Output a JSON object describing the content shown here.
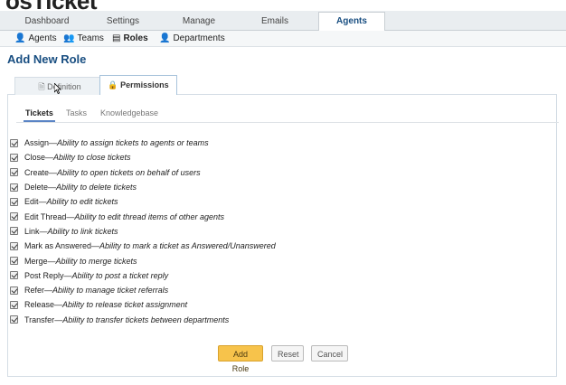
{
  "brand": {
    "logo_text": "osTicket",
    "logo_prefix": "o"
  },
  "main_nav": {
    "tabs": [
      {
        "label": "Dashboard"
      },
      {
        "label": "Settings"
      },
      {
        "label": "Manage"
      },
      {
        "label": "Emails"
      },
      {
        "label": "Agents",
        "active": true
      }
    ]
  },
  "sub_nav": {
    "items": [
      {
        "label": "Agents",
        "icon": "agent-icon"
      },
      {
        "label": "Teams",
        "icon": "teams-icon"
      },
      {
        "label": "Roles",
        "icon": "roles-icon",
        "active": true
      },
      {
        "label": "Departments",
        "icon": "departments-icon"
      }
    ]
  },
  "page": {
    "title": "Add New Role"
  },
  "section_tabs": {
    "definition": {
      "label": "Definition",
      "icon": "document-icon"
    },
    "permissions": {
      "label": "Permissions",
      "icon": "lock-icon",
      "active": true
    }
  },
  "inner_tabs": {
    "tickets": "Tickets",
    "tasks": "Tasks",
    "knowledgebase": "Knowledgebase"
  },
  "permissions": [
    {
      "name": "Assign",
      "sep": " — ",
      "desc": "Ability to assign tickets to agents or teams",
      "checked": true
    },
    {
      "name": "Close",
      "sep": " — ",
      "desc": "Ability to close tickets",
      "checked": true
    },
    {
      "name": "Create",
      "sep": " — ",
      "desc": "Ability to open tickets on behalf of users",
      "checked": true
    },
    {
      "name": "Delete",
      "sep": " — ",
      "desc": "Ability to delete tickets",
      "checked": true
    },
    {
      "name": "Edit",
      "sep": " — ",
      "desc": "Ability to edit tickets",
      "checked": true
    },
    {
      "name": "Edit Thread",
      "sep": " — ",
      "desc": "Ability to edit thread items of other agents",
      "checked": true
    },
    {
      "name": "Link",
      "sep": " — ",
      "desc": "Ability to link tickets",
      "checked": true
    },
    {
      "name": "Mark as Answered",
      "sep": " — ",
      "desc": "Ability to mark a ticket as Answered/Unanswered",
      "checked": true
    },
    {
      "name": "Merge",
      "sep": " — ",
      "desc": "Ability to merge tickets",
      "checked": true
    },
    {
      "name": "Post Reply",
      "sep": " — ",
      "desc": "Ability to post a ticket reply",
      "checked": true
    },
    {
      "name": "Refer",
      "sep": " — ",
      "desc": "Ability to manage ticket referrals",
      "checked": true
    },
    {
      "name": "Release",
      "sep": " — ",
      "desc": "Ability to release ticket assignment",
      "checked": true
    },
    {
      "name": "Transfer",
      "sep": " — ",
      "desc": "Ability to transfer tickets between departments",
      "checked": true
    }
  ],
  "actions": {
    "add_role": "Add Role",
    "reset": "Reset",
    "cancel": "Cancel"
  },
  "colors": {
    "accent": "#184e81",
    "primary_button": "#f7c34b"
  }
}
